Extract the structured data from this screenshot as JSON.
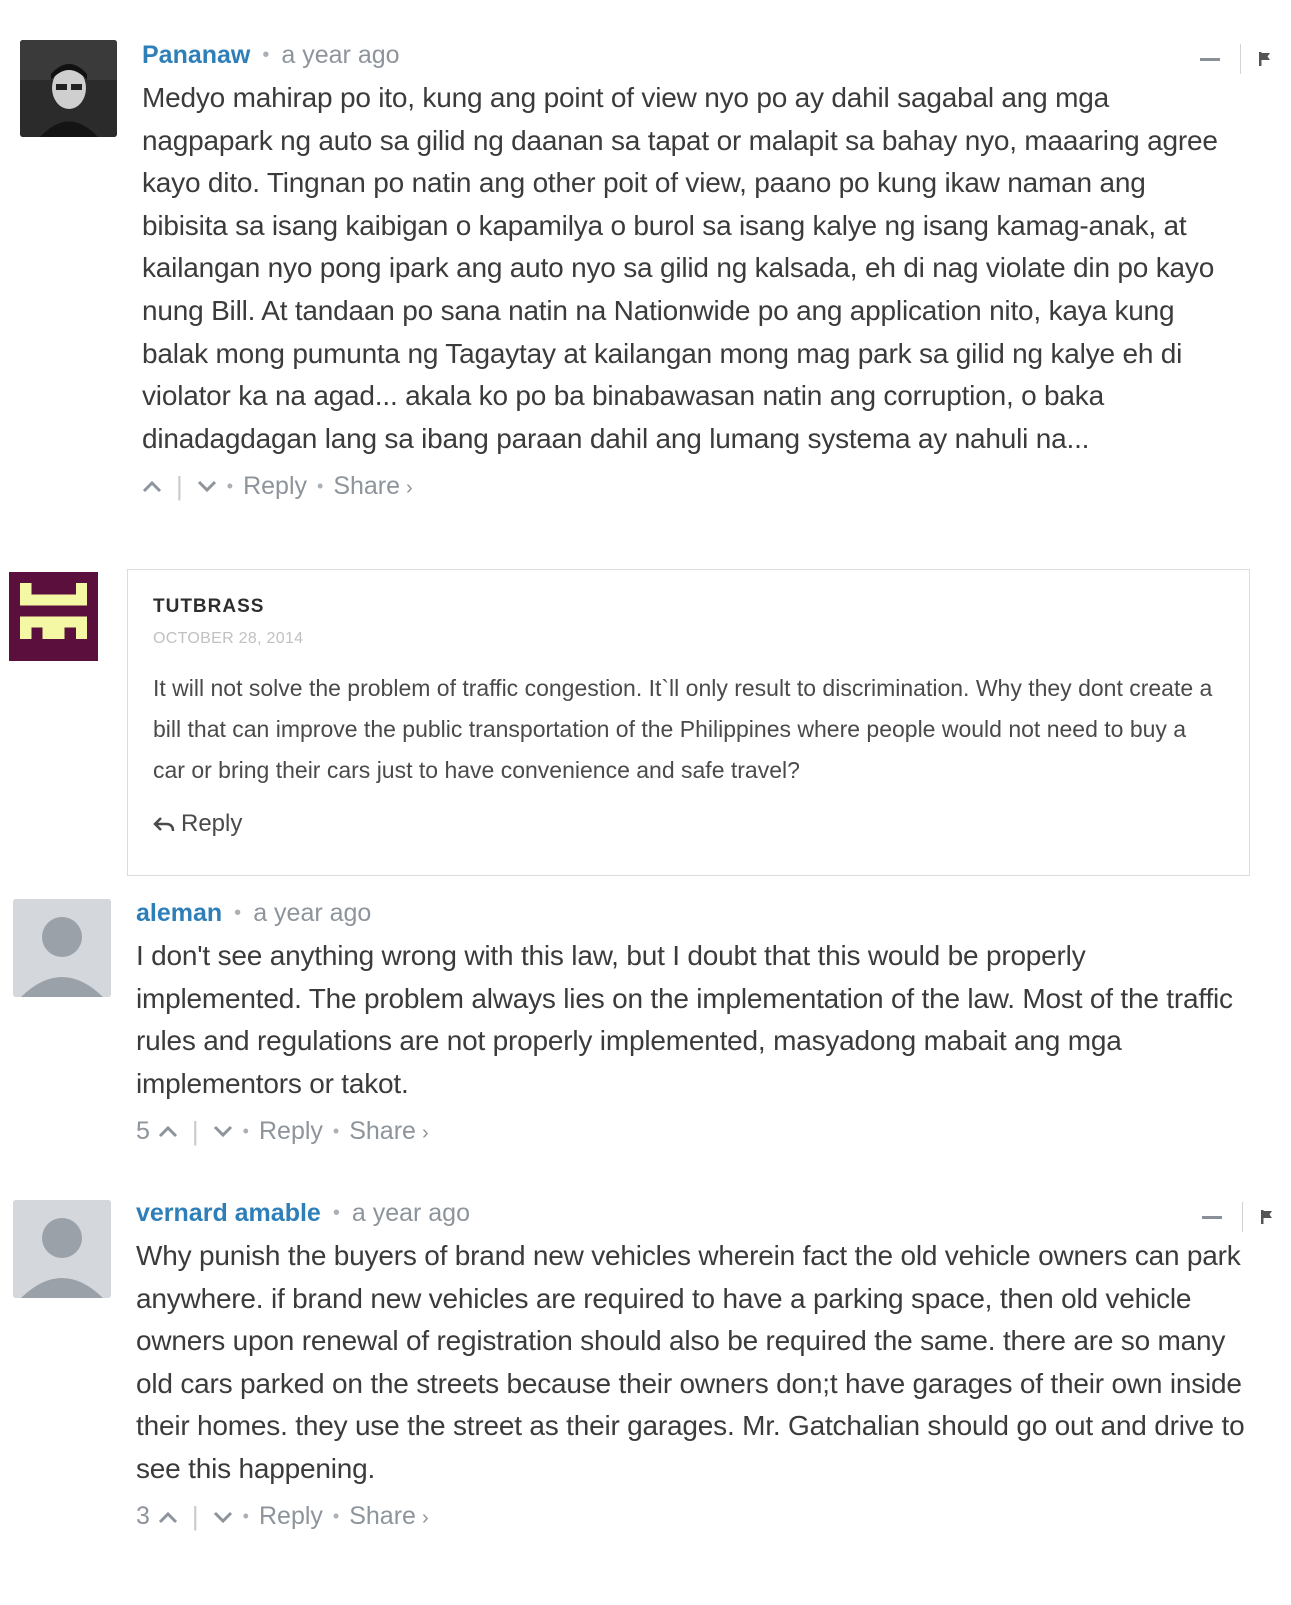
{
  "comments": [
    {
      "author": "Pananaw",
      "time": "a year ago",
      "text": "Medyo mahirap po ito, kung ang point of view nyo po ay dahil sagabal ang mga nagpapark ng auto sa gilid ng daanan sa tapat or malapit sa bahay nyo, maaaring agree kayo dito. Tingnan po natin ang other poit of view, paano po kung ikaw naman ang bibisita sa isang kaibigan o kapamilya o burol sa isang kalye ng isang kamag-anak, at kailangan nyo pong ipark ang auto nyo sa gilid ng kalsada, eh di nag violate din po kayo nung Bill. At tandaan po sana natin na Nationwide po ang application nito, kaya kung balak mong pumunta ng Tagaytay at kailangan mong mag park sa gilid ng kalye eh di violator ka na agad... akala ko po ba binabawasan natin ang corruption, o baka dinadagdagan lang sa ibang paraan dahil ang lumang systema ay nahuli na...",
      "vote_count": "",
      "reply_label": "Reply",
      "share_label": "Share"
    },
    {
      "author": "aleman",
      "time": "a year ago",
      "text": "I don't see anything wrong with this law, but I doubt that this would be properly implemented. The problem always lies on the implementation of the law. Most of the traffic rules and regulations are not properly implemented, masyadong mabait ang mga implementors or takot.",
      "vote_count": "5",
      "reply_label": "Reply",
      "share_label": "Share"
    },
    {
      "author": "vernard amable",
      "time": "a year ago",
      "text": "Why punish the buyers of brand new vehicles wherein fact the old vehicle owners can park anywhere. if brand new vehicles are required to have a parking space, then old vehicle owners upon renewal of registration should also be required the same. there are so many old cars parked on the streets because their owners don;t have garages of their own inside their homes. they use the street as their garages. Mr. Gatchalian should go out and drive to see this happening.",
      "vote_count": "3",
      "reply_label": "Reply",
      "share_label": "Share"
    }
  ],
  "card": {
    "author": "TUTBRASS",
    "date": "OCTOBER 28, 2014",
    "text": "It will not solve the problem of traffic congestion. It`ll only result to discrimination. Why they dont create a bill that can improve the public transportation of the Philippines where people would not need to buy a car or bring their cars just to have convenience and safe travel?",
    "reply_label": "Reply"
  },
  "colors": {
    "author_link": "#2e7fb8",
    "meta_gray": "#8d949b",
    "avatar_pixel_bg": "#5a0f3c",
    "avatar_pixel_fg": "#f4f7a3"
  },
  "icons": {
    "upvote": "chevron-up-icon",
    "downvote": "chevron-down-icon",
    "flag": "flag-icon",
    "collapse": "minus-icon",
    "reply": "reply-arrow-icon"
  }
}
